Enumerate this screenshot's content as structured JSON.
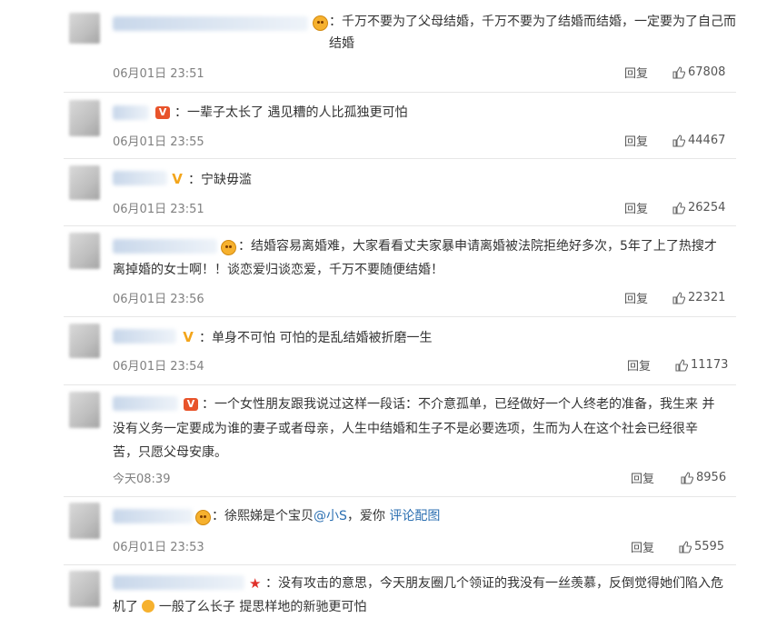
{
  "comments": [
    {
      "text": "：千万不要为了父母结婚，千万不要为了结婚而结婚，一定要为了自己而结婚",
      "time": "06月01日 23:51",
      "reply": "回复",
      "likes": "67808"
    },
    {
      "text": "：一辈子太长了 遇见糟的人比孤独更可怕",
      "time": "06月01日 23:55",
      "reply": "回复",
      "likes": "44467"
    },
    {
      "text": "：宁缺毋滥",
      "time": "06月01日 23:51",
      "reply": "回复",
      "likes": "26254"
    },
    {
      "text_line1": "：结婚容易离婚难，大家看看丈夫家暴申请离婚被法院拒绝好多次，5年了上了热搜才",
      "text_line2": "离掉婚的女士啊！！谈恋爱归谈恋爱，千万不要随便结婚！",
      "time": "06月01日 23:56",
      "reply": "回复",
      "likes": "22321"
    },
    {
      "text": "：单身不可怕 可怕的是乱结婚被折磨一生",
      "time": "06月01日 23:54",
      "reply": "回复",
      "likes": "11173"
    },
    {
      "text_line1": "：一个女性朋友跟我说过这样一段话：不介意孤单，已经做好一个人终老的准备，我生来 并",
      "text_line2": "没有义务一定要成为谁的妻子或者母亲，人生中结婚和生子不是必要选项，生而为人在这个社会已经很辛",
      "text_line3": "苦，只愿父母安康。",
      "time": "今天08:39",
      "reply": "回复",
      "likes": "8956"
    },
    {
      "text_prefix": "：徐熙娣是个宝贝",
      "mention": "@小S",
      "text_suffix": "，爱你 ",
      "link": "评论配图",
      "time": "06月01日 23:53",
      "reply": "回复",
      "likes": "5595"
    },
    {
      "text_line1": "：没有攻击的意思，今天朋友圈几个领证的我没有一丝羡慕，反倒觉得她们陷入危",
      "text_line2": "机了",
      "text_line2_rest": "一般了么长子 提思样地的新驰更可怕"
    }
  ]
}
